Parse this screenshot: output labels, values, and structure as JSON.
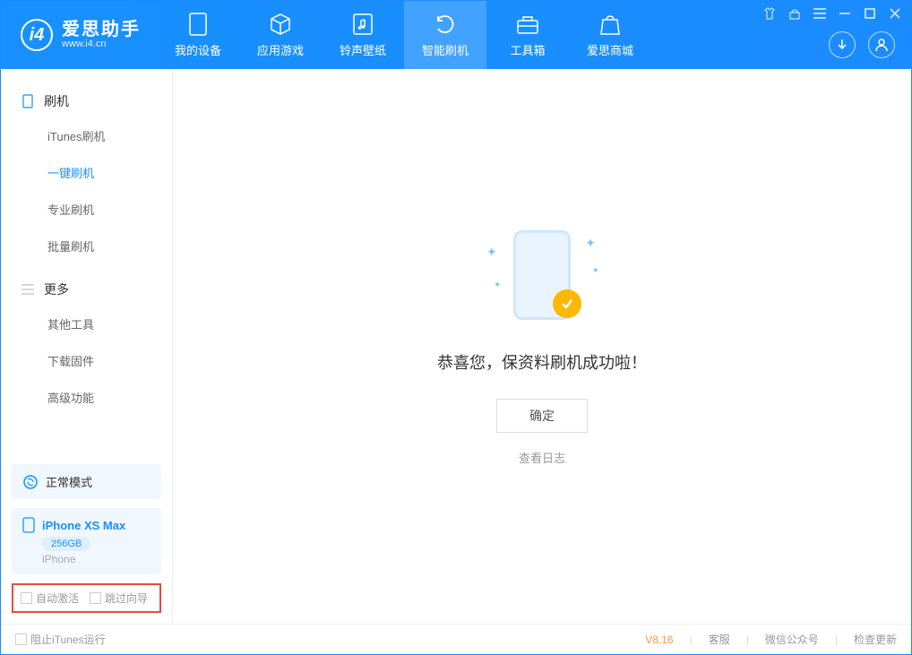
{
  "app": {
    "name_cn": "爱思助手",
    "name_en": "www.i4.cn"
  },
  "nav": [
    {
      "label": "我的设备"
    },
    {
      "label": "应用游戏"
    },
    {
      "label": "铃声壁纸"
    },
    {
      "label": "智能刷机"
    },
    {
      "label": "工具箱"
    },
    {
      "label": "爱思商城"
    }
  ],
  "sidebar": {
    "group1": {
      "title": "刷机",
      "items": [
        "iTunes刷机",
        "一键刷机",
        "专业刷机",
        "批量刷机"
      ]
    },
    "group2": {
      "title": "更多",
      "items": [
        "其他工具",
        "下载固件",
        "高级功能"
      ]
    }
  },
  "mode": {
    "label": "正常模式"
  },
  "device": {
    "name": "iPhone XS Max",
    "storage": "256GB",
    "type": "iPhone"
  },
  "checkboxes": {
    "auto_activate": "自动激活",
    "skip_guide": "跳过向导"
  },
  "main": {
    "message": "恭喜您，保资料刷机成功啦！",
    "ok": "确定",
    "view_log": "查看日志"
  },
  "footer": {
    "block_itunes": "阻止iTunes运行",
    "version": "V8.16",
    "service": "客服",
    "wechat": "微信公众号",
    "update": "检查更新"
  }
}
